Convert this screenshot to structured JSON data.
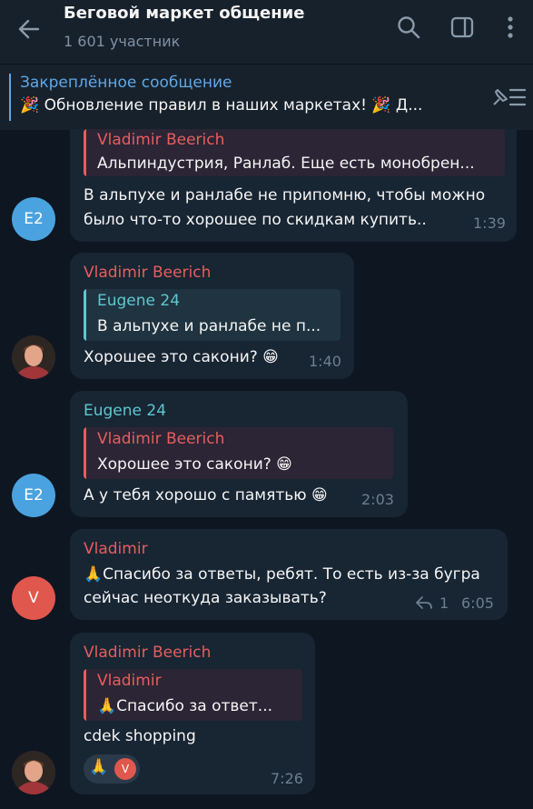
{
  "header": {
    "title": "Беговой маркет общение",
    "subtitle": "1 601 участник"
  },
  "pinned": {
    "title": "Закреплённое сообщение",
    "text": "🎉 Обновление правил в наших маркетах! 🎉 Д..."
  },
  "colors": {
    "red_name": "#e65e5e",
    "teal_name": "#5fc6cf",
    "accent": "#5fa8e8"
  },
  "messages": [
    {
      "quote_author": "Vladimir Beerich",
      "quote_text": "Альпиндустрия, Ранлаб. Еще есть монобрен...",
      "line1": "В альпухе и ранлабе не припомню, чтобы можно",
      "line2": "было что-то хорошее по скидкам купить..",
      "time": "1:39",
      "avatar": "E2"
    },
    {
      "author": "Vladimir Beerich",
      "quote_author": "Eugene 24",
      "quote_text": "В альпухе и ранлабе не п...",
      "text": "Хорошее это сакони? 😁",
      "time": "1:40"
    },
    {
      "author": "Eugene 24",
      "quote_author": "Vladimir Beerich",
      "quote_text": "Хорошее это сакони? 😁",
      "text": "А у тебя хорошо с памятью 😁",
      "time": "2:03",
      "avatar": "E2"
    },
    {
      "author": "Vladimir",
      "line1": "🙏Спасибо за ответы, ребят. То есть из-за бугра",
      "line2": "сейчас неоткуда заказывать?",
      "replies": "1",
      "time": "6:05",
      "avatar": "V"
    },
    {
      "author": "Vladimir Beerich",
      "quote_author": "Vladimir",
      "quote_text": "🙏Спасибо за ответ...",
      "text": "cdek shopping",
      "reaction": "🙏",
      "reaction_avatar": "V",
      "time": "7:26"
    }
  ]
}
